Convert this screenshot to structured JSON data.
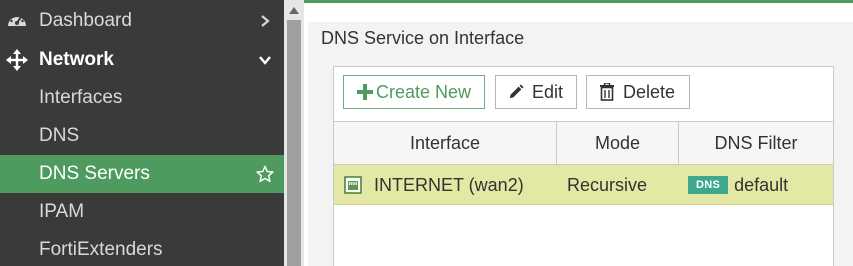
{
  "sidebar": {
    "items": [
      {
        "label": "Dashboard",
        "icon": "dashboard-gauge-icon",
        "trail": "chevron-right-icon"
      },
      {
        "label": "Network",
        "icon": "move-arrows-icon",
        "trail": "chevron-down-icon"
      },
      {
        "label": "Interfaces"
      },
      {
        "label": "DNS"
      },
      {
        "label": "DNS Servers",
        "trail": "star-outline-icon",
        "active": true
      },
      {
        "label": "IPAM"
      },
      {
        "label": "FortiExtenders"
      }
    ]
  },
  "main": {
    "title": "DNS Service on Interface",
    "toolbar": {
      "create_label": "Create New",
      "edit_label": "Edit",
      "delete_label": "Delete"
    },
    "table": {
      "columns": [
        "Interface",
        "Mode",
        "DNS Filter"
      ],
      "rows": [
        {
          "interface": "INTERNET (wan2)",
          "mode": "Recursive",
          "filter_badge": "DNS",
          "filter": "default",
          "icon": "network-port-icon"
        }
      ]
    }
  },
  "colors": {
    "sidebar_bg": "#3a3a3a",
    "accent_green": "#4e9a5f",
    "selected_row": "#e3e8a4",
    "dns_badge": "#3ea88e"
  }
}
